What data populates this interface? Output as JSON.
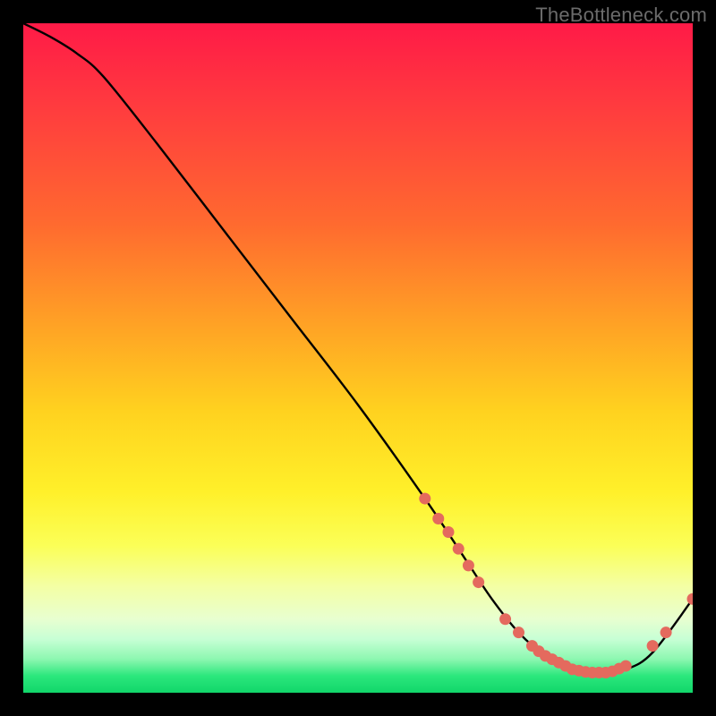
{
  "watermark": "TheBottleneck.com",
  "colors": {
    "curve_stroke": "#000000",
    "marker_fill": "#e46a5e",
    "marker_stroke": "#e46a5e"
  },
  "chart_data": {
    "type": "line",
    "title": "",
    "xlabel": "",
    "ylabel": "",
    "xlim": [
      0,
      100
    ],
    "ylim": [
      0,
      100
    ],
    "grid": false,
    "legend": false,
    "series": [
      {
        "name": "bottleneck-curve",
        "x": [
          0,
          4,
          8,
          12,
          20,
          30,
          40,
          50,
          60,
          66,
          70,
          74,
          78,
          82,
          86,
          90,
          94,
          100
        ],
        "y": [
          100,
          98,
          95.5,
          92,
          82,
          69,
          56,
          43,
          29,
          20,
          14,
          9,
          5.5,
          3.5,
          3,
          3.5,
          6,
          14
        ]
      }
    ],
    "markers": [
      {
        "x": 60,
        "y": 29
      },
      {
        "x": 62,
        "y": 26
      },
      {
        "x": 63.5,
        "y": 24
      },
      {
        "x": 65,
        "y": 21.5
      },
      {
        "x": 66.5,
        "y": 19
      },
      {
        "x": 68,
        "y": 16.5
      },
      {
        "x": 72,
        "y": 11
      },
      {
        "x": 74,
        "y": 9
      },
      {
        "x": 76,
        "y": 7
      },
      {
        "x": 77,
        "y": 6.2
      },
      {
        "x": 78,
        "y": 5.5
      },
      {
        "x": 79,
        "y": 5
      },
      {
        "x": 80,
        "y": 4.5
      },
      {
        "x": 81,
        "y": 4
      },
      {
        "x": 82,
        "y": 3.5
      },
      {
        "x": 83,
        "y": 3.3
      },
      {
        "x": 84,
        "y": 3.1
      },
      {
        "x": 85,
        "y": 3
      },
      {
        "x": 86,
        "y": 3
      },
      {
        "x": 87,
        "y": 3
      },
      {
        "x": 88,
        "y": 3.2
      },
      {
        "x": 89,
        "y": 3.6
      },
      {
        "x": 90,
        "y": 4
      },
      {
        "x": 94,
        "y": 7
      },
      {
        "x": 96,
        "y": 9
      },
      {
        "x": 100,
        "y": 14
      }
    ]
  }
}
